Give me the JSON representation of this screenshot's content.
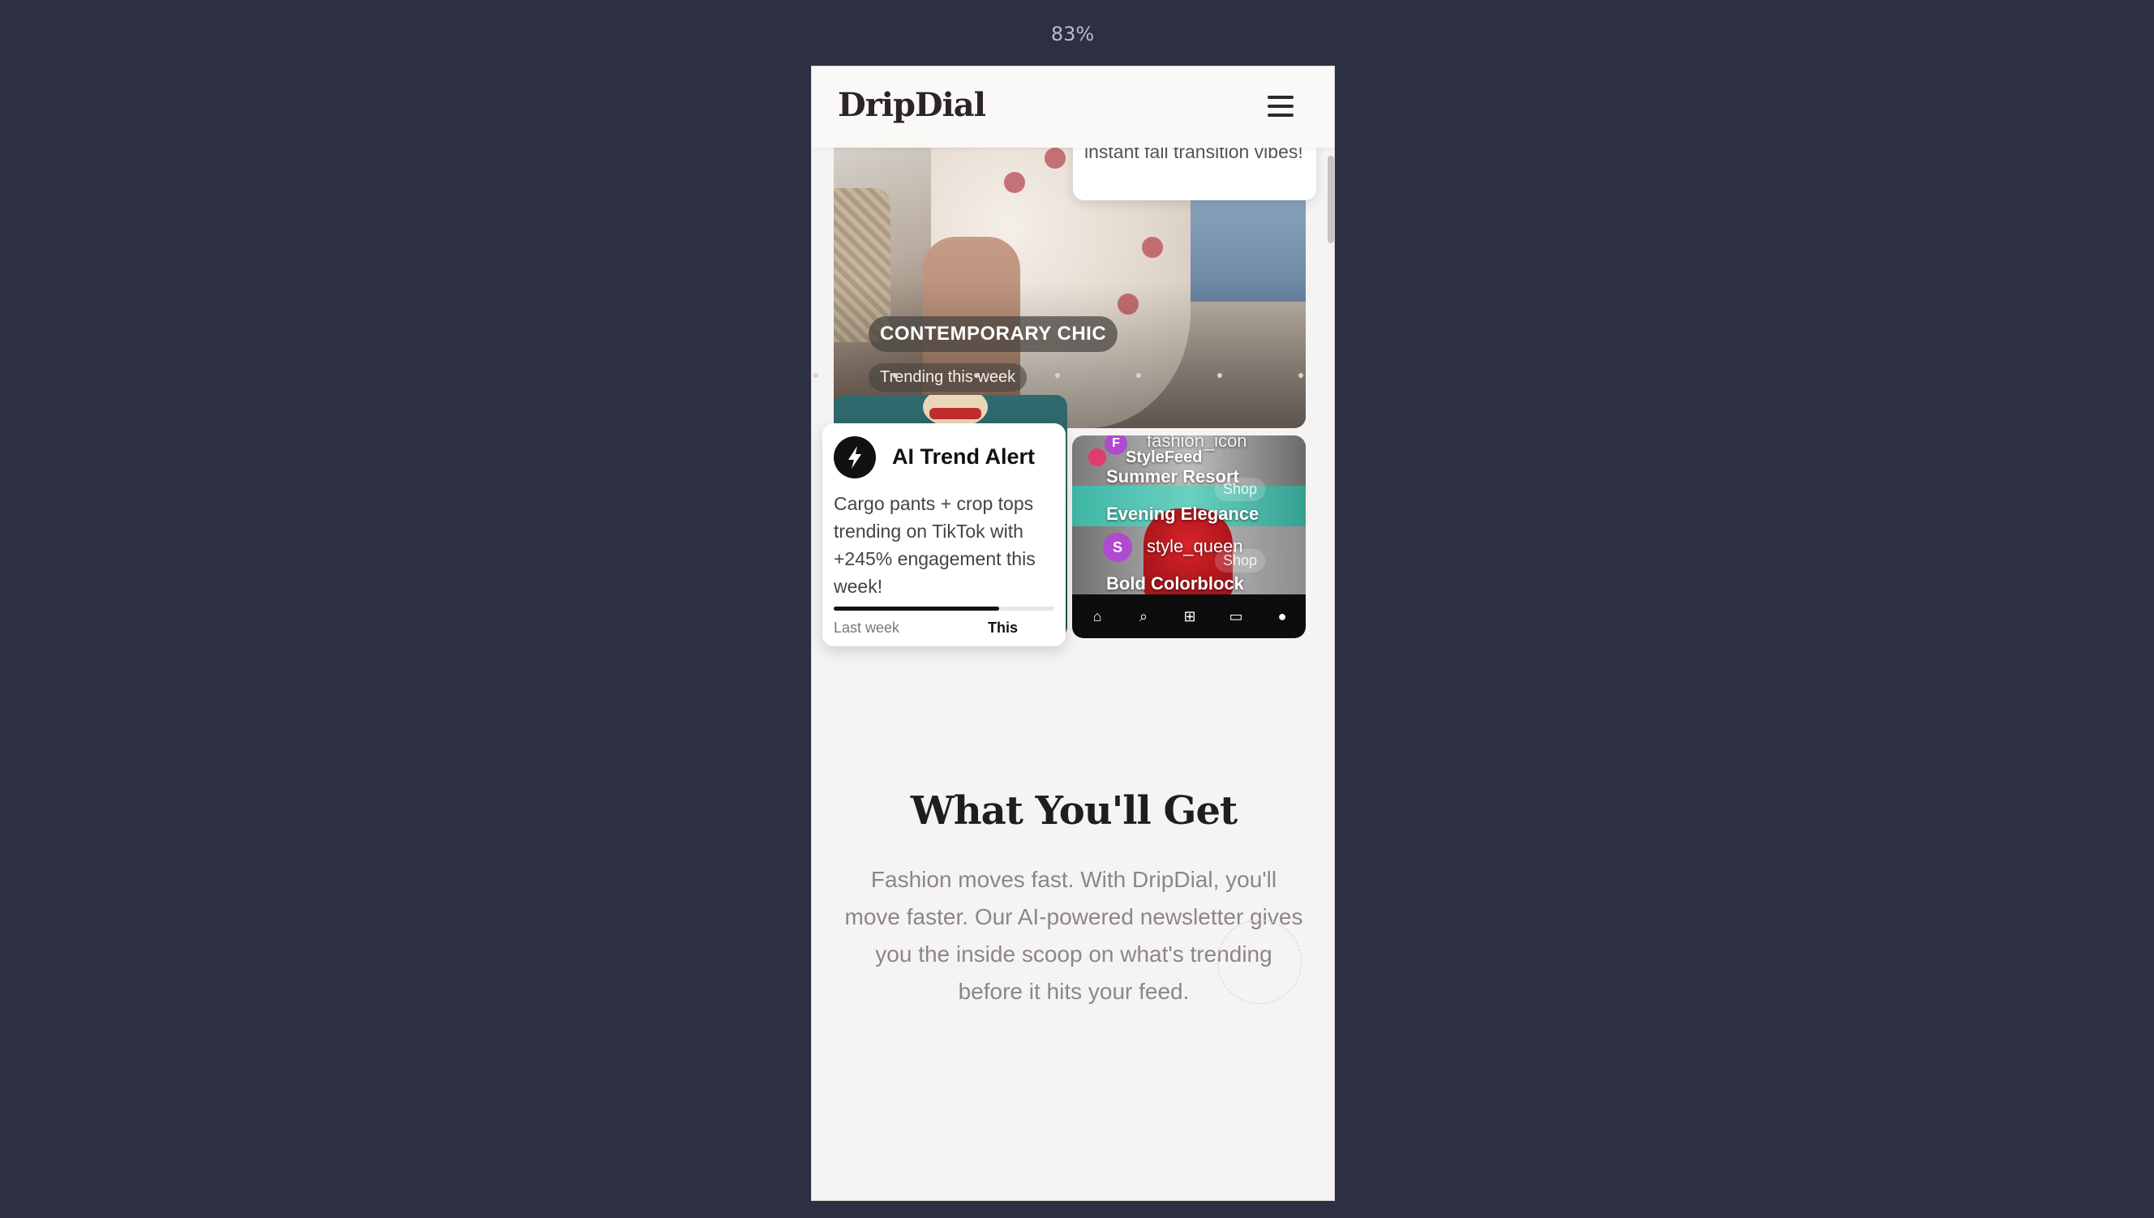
{
  "zoom": "83%",
  "header": {
    "logo": "DripDial"
  },
  "hero": {
    "quote": "instant fall transition vibes!",
    "tag": "CONTEMPORARY CHIC",
    "subtag": "Trending this week"
  },
  "alert": {
    "title": "AI Trend Alert",
    "body": "Cargo pants + crop tops trending on TikTok with +245% engagement this week!",
    "last_label": "Last week",
    "this_label": "This w",
    "progress": 0.75
  },
  "preview": {
    "user1_initial": "F",
    "user1": "fashion_icon",
    "app_name": "StyleFeed",
    "item1": "Summer Resort",
    "item2": "Evening Elegance",
    "user2_initial": "S",
    "user2": "style_queen",
    "item3": "Bold Colorblock",
    "shop_label": "Shop"
  },
  "section": {
    "title": "What You'll Get",
    "body": "Fashion moves fast. With DripDial, you'll move faster. Our AI-powered newsletter gives you the inside scoop on what's trending before it hits your feed."
  }
}
